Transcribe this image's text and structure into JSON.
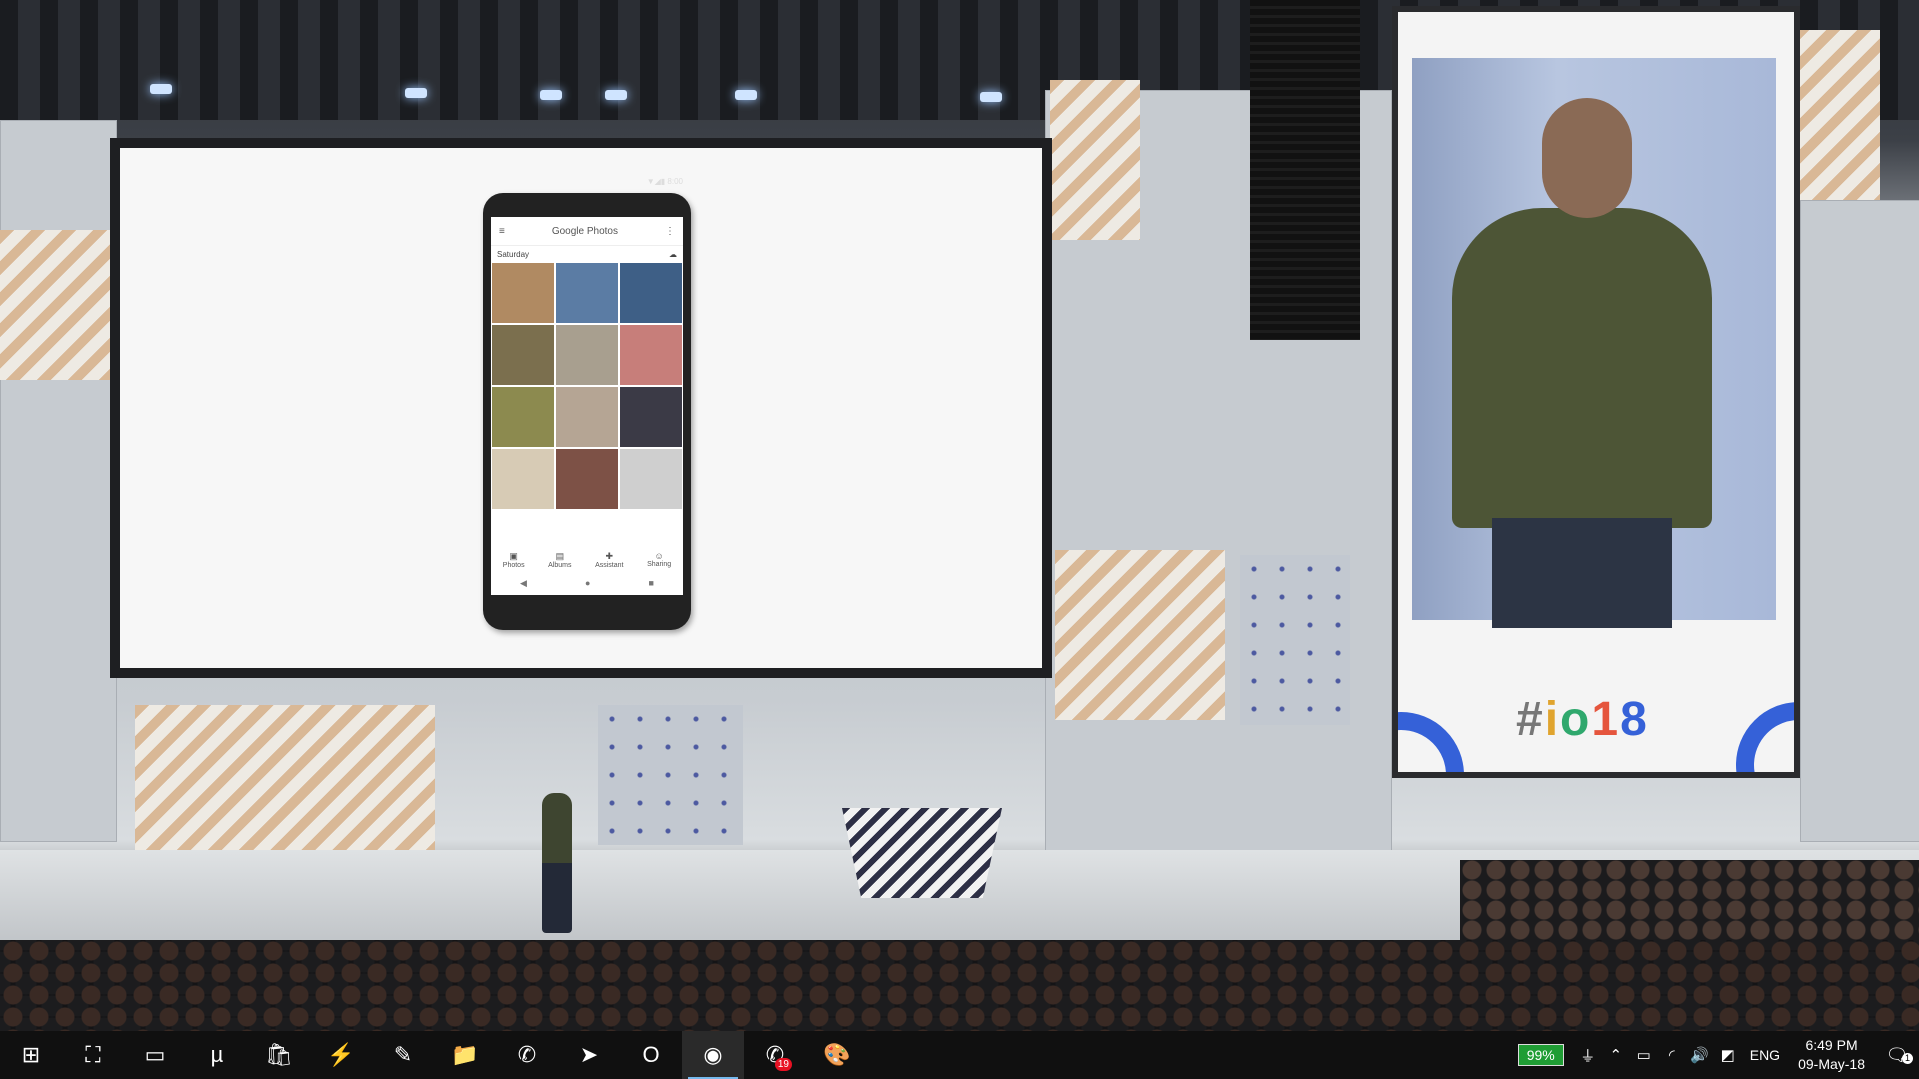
{
  "phone": {
    "app_title": "Google Photos",
    "status": "▼◢▮ 8:00",
    "section_label": "Saturday",
    "tabs": [
      "Photos",
      "Albums",
      "Assistant",
      "Sharing"
    ],
    "photo_colors": [
      "#b08a62",
      "#5b7ca4",
      "#3e5f86",
      "#7b6f4e",
      "#a89f8f",
      "#c77e7a",
      "#8c8a4f",
      "#b5a594",
      "#3b3a46",
      "#d7cbb5",
      "#7d5146",
      "#cfcfcf"
    ]
  },
  "side_screen": {
    "logo_text": "#io18"
  },
  "taskbar": {
    "apps": [
      {
        "name": "start-icon",
        "glyph": "⊞"
      },
      {
        "name": "photo-editor-icon",
        "glyph": "⛶"
      },
      {
        "name": "monitor-app-icon",
        "glyph": "▭"
      },
      {
        "name": "utorrent-icon",
        "glyph": "µ"
      },
      {
        "name": "store-icon",
        "glyph": "🛍"
      },
      {
        "name": "flash-app-icon",
        "glyph": "⚡"
      },
      {
        "name": "paint-icon",
        "glyph": "✎"
      },
      {
        "name": "file-explorer-icon",
        "glyph": "📁"
      },
      {
        "name": "whatsapp-icon",
        "glyph": "✆"
      },
      {
        "name": "telegram-icon",
        "glyph": "➤"
      },
      {
        "name": "opera-icon",
        "glyph": "O"
      },
      {
        "name": "chrome-icon",
        "glyph": "◉"
      },
      {
        "name": "whatsapp-badged-icon",
        "glyph": "✆",
        "badge": "19"
      },
      {
        "name": "paint-palette-icon",
        "glyph": "🎨"
      }
    ],
    "battery": "99%",
    "language": "ENG",
    "time": "6:49 PM",
    "date": "09-May-18",
    "notification_count": "1",
    "colors": {
      "taskbar_bg": "#101010",
      "battery_bg": "#1f9d34",
      "accent": "#76b9ed"
    }
  }
}
